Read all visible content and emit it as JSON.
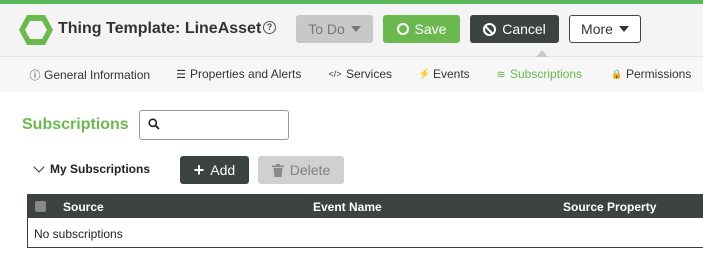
{
  "header": {
    "title": "Thing Template: LineAsset",
    "state_label": "To Do",
    "save_label": "Save",
    "cancel_label": "Cancel",
    "more_label": "More",
    "brand_color": "#6bb84e",
    "dark_color": "#3d4340",
    "icons": {
      "logo": "hexagon-logo-icon",
      "help": "help-circle-icon",
      "save": "circle-icon",
      "cancel": "ban-icon",
      "dropdown": "caret-down-icon"
    }
  },
  "tabs": [
    {
      "label": "General Information",
      "icon": "info-icon",
      "glyph": "ⓘ",
      "active": false
    },
    {
      "label": "Properties and Alerts",
      "icon": "list-icon",
      "glyph": "☰",
      "active": false
    },
    {
      "label": "Services",
      "icon": "code-icon",
      "glyph": "</>",
      "active": false
    },
    {
      "label": "Events",
      "icon": "bolt-icon",
      "glyph": "⚡",
      "active": false
    },
    {
      "label": "Subscriptions",
      "icon": "rss-icon",
      "glyph": "≋",
      "active": true
    },
    {
      "label": "Permissions",
      "icon": "lock-icon",
      "glyph": "🔒",
      "active": false
    }
  ],
  "main": {
    "section_title": "Subscriptions",
    "search": {
      "value": "",
      "placeholder": ""
    },
    "group_label": "My Subscriptions",
    "add_label": "Add",
    "delete_label": "Delete",
    "table": {
      "columns": [
        "Source",
        "Event Name",
        "Source Property"
      ],
      "rows": [],
      "empty_text": "No subscriptions"
    }
  }
}
